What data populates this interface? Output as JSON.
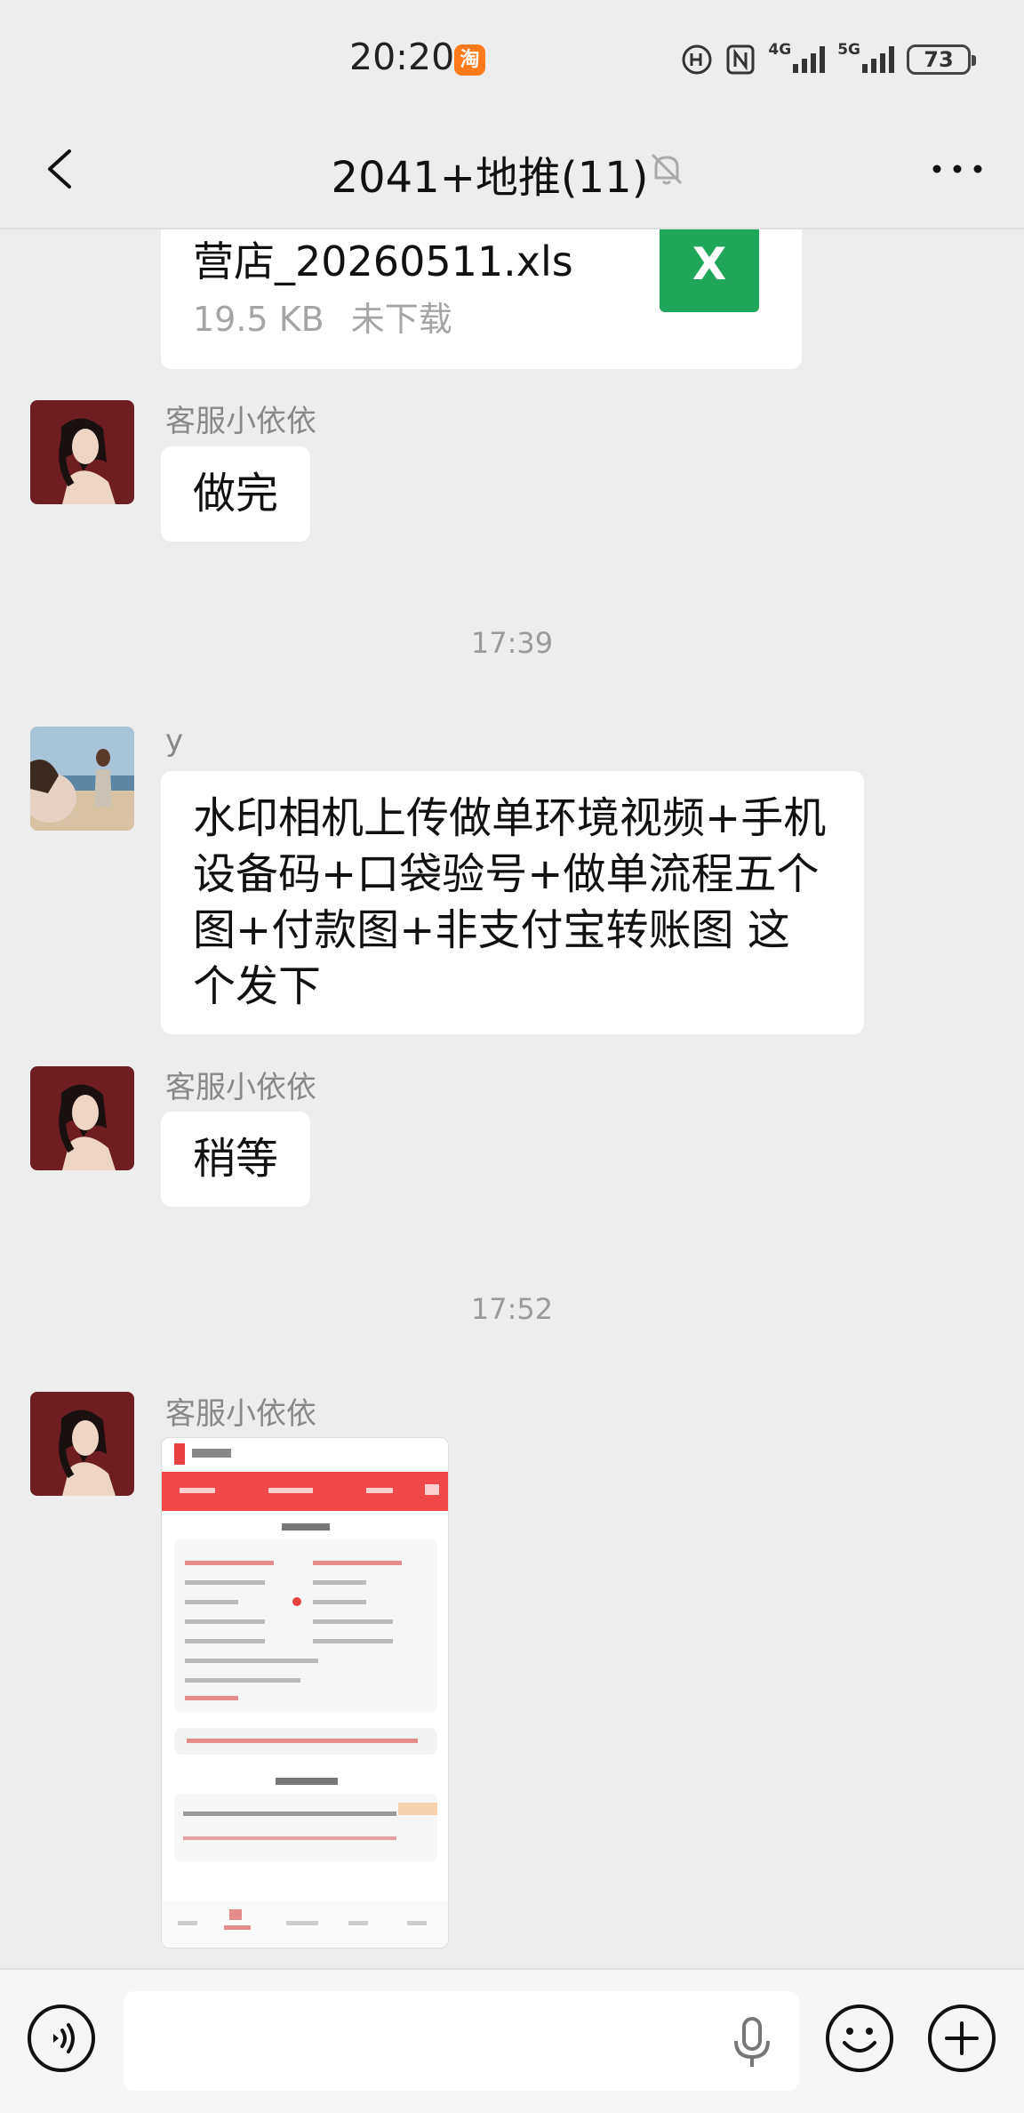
{
  "status_bar": {
    "time": "20:20",
    "app_badge": "淘",
    "network_4g": "4G",
    "network_5g": "5G",
    "battery": "73"
  },
  "header": {
    "title": "2041+地推(11)"
  },
  "messages": {
    "file": {
      "name": "营店_20260511.xls",
      "size": "19.5 KB",
      "status": "未下载",
      "icon_letter": "X"
    },
    "msg1": {
      "sender": "客服小依依",
      "text": "做完"
    },
    "time1": "17:39",
    "msg2": {
      "sender": "y",
      "text": "水印相机上传做单环境视频+手机设备码+口袋验号+做单流程五个图+付款图+非支付宝转账图 这个发下"
    },
    "msg3": {
      "sender": "客服小依依",
      "text": "稍等"
    },
    "time2": "17:52",
    "msg4": {
      "sender": "客服小依依"
    }
  },
  "input_bar": {
    "placeholder": ""
  },
  "colors": {
    "background": "#ededed",
    "bubble": "#ffffff",
    "excel_green": "#1fa65a",
    "app_red": "#f04848"
  }
}
